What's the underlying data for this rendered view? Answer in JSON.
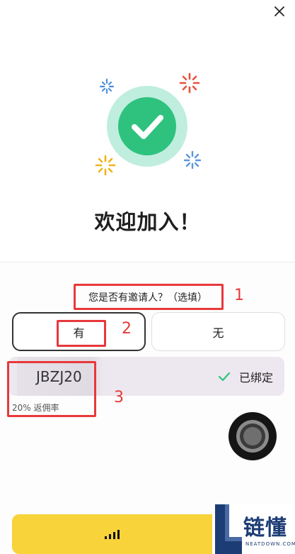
{
  "hero": {
    "title": "欢迎加入！",
    "icon": "check-circle-icon"
  },
  "invite": {
    "question": "您是否有邀请人？（选填）",
    "options": [
      {
        "label": "有",
        "selected": true
      },
      {
        "label": "无",
        "selected": false
      }
    ],
    "code": "JBZJ20",
    "status": "已绑定",
    "rate": "20% 返佣率"
  },
  "annotations": [
    "1",
    "2",
    "3"
  ],
  "watermark": {
    "brand": "链懂",
    "domain": "NEATDOWN.COM"
  },
  "colors": {
    "accent_green": "#2ec27e",
    "button_yellow": "#f8d33a",
    "annotation_red": "#e8383b",
    "code_bg": "#ede8f0"
  }
}
